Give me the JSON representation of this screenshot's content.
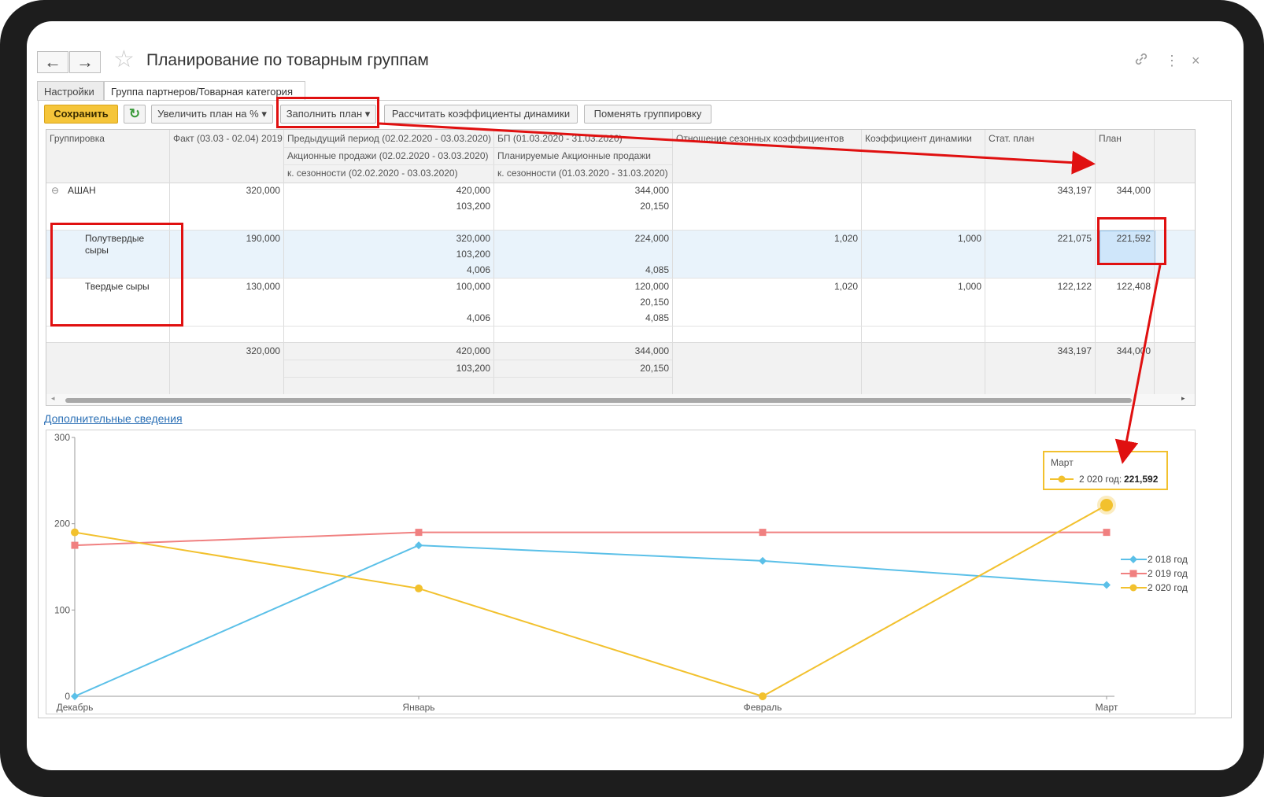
{
  "window": {
    "title": "Планирование по товарным группам",
    "back_icon": "←",
    "forward_icon": "→",
    "star_icon": "☆",
    "link_icon": "🔗",
    "more_icon": "⋮",
    "close_icon": "×"
  },
  "tabs": [
    {
      "label": "Настройки",
      "active": false
    },
    {
      "label": "Группа партнеров/Товарная категория",
      "active": true
    }
  ],
  "toolbar": {
    "save_label": "Сохранить",
    "refresh_icon": "↻",
    "increase_label": "Увеличить план на %",
    "fill_label": "Заполнить план",
    "calc_label": "Рассчитать коэффициенты динамики",
    "regroup_label": "Поменять группировку"
  },
  "table": {
    "headers": {
      "group": "Группировка",
      "fact": "Факт (03.03 - 02.04) 2019",
      "prev1": "Предыдущий период (02.02.2020 - 03.03.2020)",
      "prev2": "Акционные продажи (02.02.2020 - 03.03.2020)",
      "prev3": "к. сезонности (02.02.2020 - 03.03.2020)",
      "bp1": "БП (01.03.2020 - 31.03.2020)",
      "bp2": "Планируемые Акционные продажи",
      "bp3": "к. сезонности (01.03.2020 - 31.03.2020)",
      "seasonal": "Отношение сезонных коэффициентов",
      "dynamics": "Коэффициент динамики",
      "stat": "Стат. план",
      "plan": "План"
    },
    "rows": [
      {
        "name": "АШАН",
        "collapse_icon": "⊖",
        "fact": "320,000",
        "prev": [
          "420,000",
          "103,200",
          ""
        ],
        "bp": [
          "344,000",
          "20,150",
          ""
        ],
        "seasonal": "",
        "dynamics": "",
        "stat": "343,197",
        "plan": "344,000"
      },
      {
        "name_line1": "Полутвердые",
        "name_line2": "сыры",
        "fact": "190,000",
        "prev": [
          "320,000",
          "103,200",
          "4,006"
        ],
        "bp": [
          "224,000",
          "",
          "4,085"
        ],
        "seasonal": "1,020",
        "dynamics": "1,000",
        "stat": "221,075",
        "plan": "221,592"
      },
      {
        "name": "Твердые сыры",
        "fact": "130,000",
        "prev": [
          "100,000",
          "",
          "4,006"
        ],
        "bp": [
          "120,000",
          "20,150",
          "4,085"
        ],
        "seasonal": "1,020",
        "dynamics": "1,000",
        "stat": "122,122",
        "plan": "122,408"
      }
    ],
    "totals": {
      "fact": "320,000",
      "prev": [
        "420,000",
        "103,200"
      ],
      "bp": [
        "344,000",
        "20,150"
      ],
      "stat": "343,197",
      "plan": "344,000"
    }
  },
  "extra_link": "Дополнительные сведения",
  "chart_data": {
    "type": "line",
    "categories": [
      "Декабрь",
      "Январь",
      "Февраль",
      "Март"
    ],
    "ylim": [
      0,
      300
    ],
    "yticks": [
      "0",
      "100",
      "200",
      "300"
    ],
    "series": [
      {
        "name": "2 018 год",
        "color": "#5bc0e8",
        "marker": "diamond",
        "values": [
          0,
          175,
          157,
          129
        ]
      },
      {
        "name": "2 019 год",
        "color": "#f08080",
        "marker": "square",
        "values": [
          175,
          190,
          190,
          190
        ]
      },
      {
        "name": "2 020 год",
        "color": "#f2c12e",
        "marker": "circle",
        "values": [
          190,
          125,
          0,
          221.592
        ]
      }
    ],
    "tooltip": {
      "title": "Март",
      "series": "2 020 год:",
      "value": "221,592"
    },
    "legend_position": "right"
  }
}
